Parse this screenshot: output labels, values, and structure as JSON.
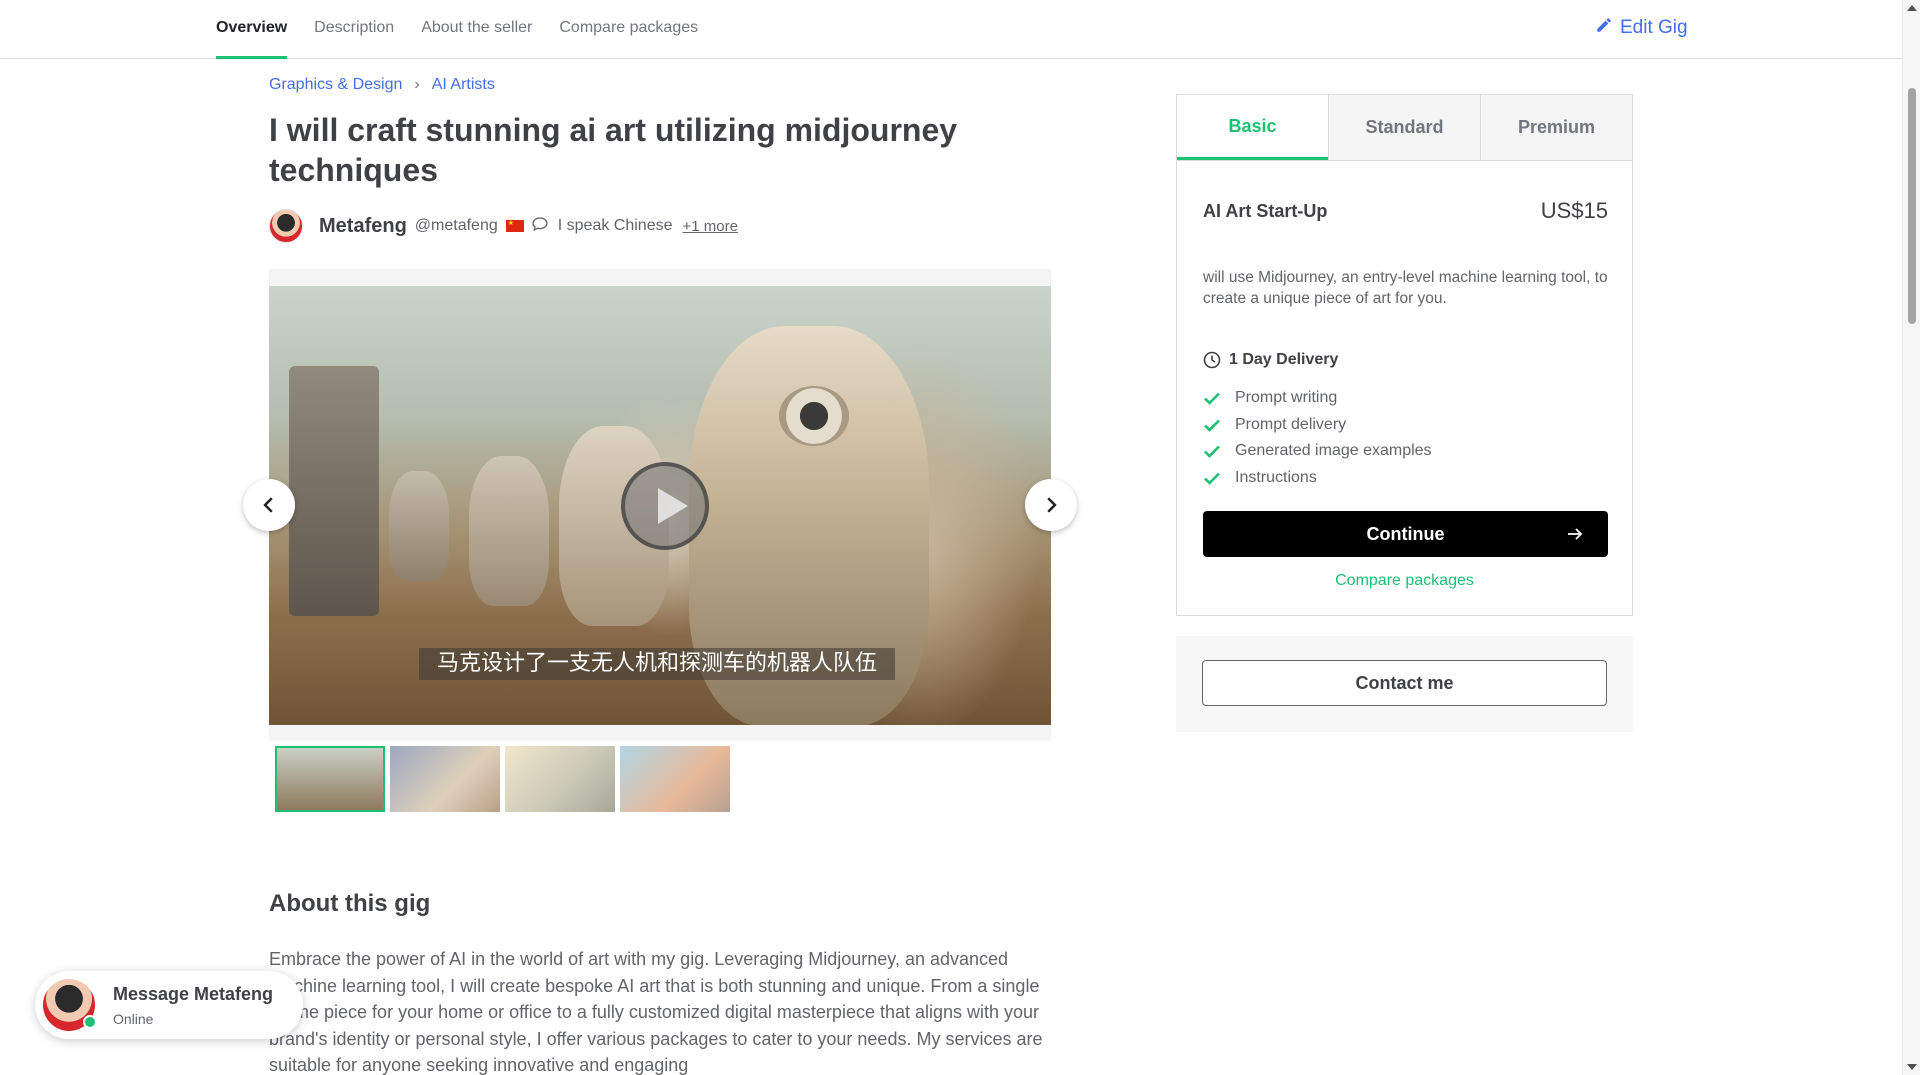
{
  "nav": {
    "tabs": [
      {
        "label": "Overview"
      },
      {
        "label": "Description"
      },
      {
        "label": "About the seller"
      },
      {
        "label": "Compare packages"
      }
    ],
    "edit_label": "Edit Gig"
  },
  "breadcrumb": {
    "items": [
      "Graphics & Design",
      "AI Artists"
    ]
  },
  "gig": {
    "title": "I will craft stunning ai art utilizing midjourney techniques"
  },
  "seller": {
    "name": "Metafeng",
    "handle": "@metafeng",
    "language": "I speak Chinese",
    "more": "+1 more"
  },
  "media": {
    "subtitle": "马克设计了一支无人机和探测车的机器人队伍"
  },
  "about": {
    "title": "About this gig",
    "text": "Embrace the power of AI in the world of art with my gig. Leveraging Midjourney, an advanced machine learning tool, I will create bespoke AI art that is both stunning and unique. From a single theme piece for your home or office to a fully customized digital masterpiece that aligns with your brand's identity or personal style, I offer various packages to cater to your needs. My services are suitable for anyone seeking innovative and engaging"
  },
  "message": {
    "name": "Message Metafeng",
    "status": "Online"
  },
  "package": {
    "tabs": [
      "Basic",
      "Standard",
      "Premium"
    ],
    "name": "AI Art Start-Up",
    "price": "US$15",
    "description": "will use Midjourney, an entry-level machine learning tool, to create a unique piece of art for you.",
    "delivery": "1 Day Delivery",
    "features": [
      "Prompt writing",
      "Prompt delivery",
      "Generated image examples",
      "Instructions"
    ],
    "continue_label": "Continue",
    "compare_label": "Compare packages",
    "contact_label": "Contact me"
  },
  "colors": {
    "accent": "#1dbf73",
    "link": "#446ee7",
    "text": "#404145"
  }
}
